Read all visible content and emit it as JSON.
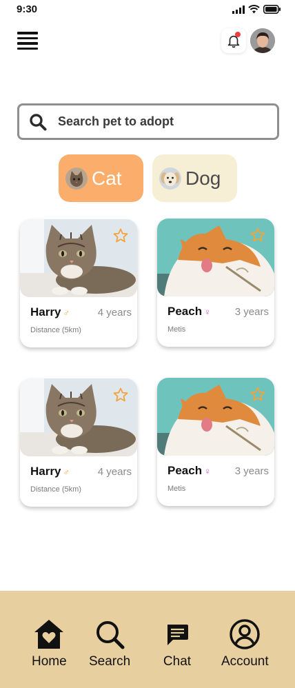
{
  "status_bar": {
    "time": "9:30"
  },
  "search": {
    "placeholder": "Search pet to adopt"
  },
  "categories": [
    {
      "label": "Cat",
      "icon": "cat-icon",
      "selected": true
    },
    {
      "label": "Dog",
      "icon": "dog-icon",
      "selected": false
    }
  ],
  "pets": [
    {
      "name": "Harry",
      "gender": "♂",
      "age": "4 years",
      "subtitle": "Distance (5km)"
    },
    {
      "name": "Peach",
      "gender": "♀",
      "age": "3 years",
      "subtitle": "Metis"
    },
    {
      "name": "Harry",
      "gender": "♂",
      "age": "4 years",
      "subtitle": "Distance (5km)"
    },
    {
      "name": "Peach",
      "gender": "♀",
      "age": "3 years",
      "subtitle": "Metis"
    }
  ],
  "nav": [
    {
      "label": "Home",
      "icon": "home-heart-icon"
    },
    {
      "label": "Search",
      "icon": "search-icon"
    },
    {
      "label": "Chat",
      "icon": "chat-icon"
    },
    {
      "label": "Account",
      "icon": "account-icon"
    }
  ],
  "colors": {
    "cat_chip": "#fbae6c",
    "dog_chip": "#f6efd5",
    "nav_background": "#e7cfa0",
    "star": "#f2a33a",
    "male": "#f2a33a",
    "female": "#d34fd9",
    "notification_dot": "#f03e3e"
  }
}
